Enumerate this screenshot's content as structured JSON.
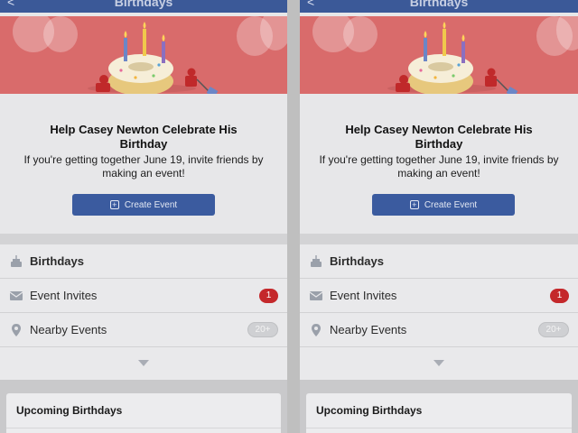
{
  "screen": {
    "title": "Birthdays",
    "back_glyph": "<"
  },
  "colors": {
    "brand_blue": "#3b5998",
    "banner_red": "#d96b6b",
    "badge_red": "#c4282b"
  },
  "prompt": {
    "headline_line1": "Help Casey Newton Celebrate His",
    "headline_line2": "Birthday",
    "subtext_line1": "If you're getting together June 19, invite friends by",
    "subtext_line2": "making an event!"
  },
  "create_button": {
    "label": "Create Event",
    "icon": "calendar-plus-icon"
  },
  "list": {
    "birthdays": {
      "label": "Birthdays",
      "icon": "cake-icon"
    },
    "event_invites": {
      "label": "Event Invites",
      "icon": "envelope-icon",
      "badge": "1"
    },
    "nearby_events": {
      "label": "Nearby Events",
      "icon": "location-pin-icon",
      "badge": "20+"
    },
    "more": {
      "icon": "chevron-down-icon"
    }
  },
  "upcoming": {
    "title": "Upcoming Birthdays"
  }
}
